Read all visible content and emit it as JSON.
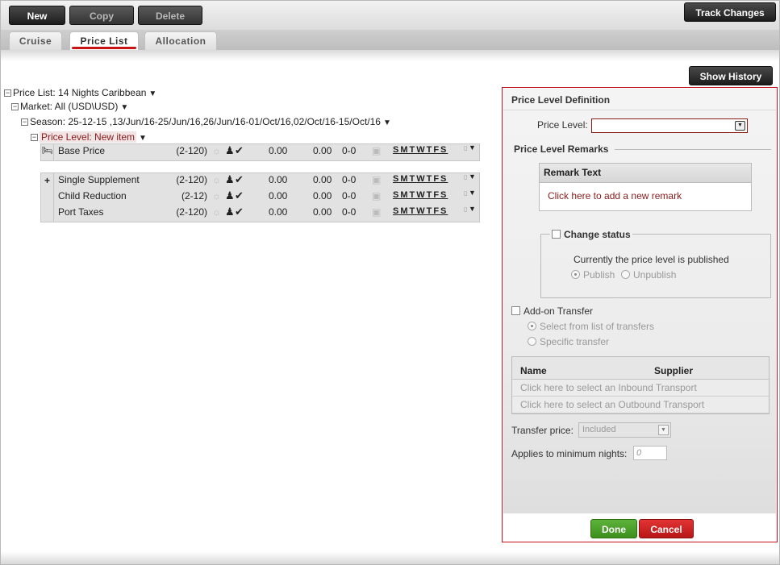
{
  "toolbar": {
    "new_label": "New",
    "copy_label": "Copy",
    "delete_label": "Delete",
    "track_changes_label": "Track Changes"
  },
  "tabs": [
    {
      "label": "Cruise",
      "active": false
    },
    {
      "label": "Price List",
      "active": true
    },
    {
      "label": "Allocation",
      "active": false
    }
  ],
  "tree": {
    "price_list": "Price List: 14 Nights Caribbean",
    "market": "Market: All (USD\\USD)",
    "season": "Season: 25-12-15 ,13/Jun/16-25/Jun/16,26/Jun/16-01/Oct/16,02/Oct/16-15/Oct/16",
    "price_level": "Price Level: New item"
  },
  "base_rows": [
    {
      "name": "Base Price",
      "range": "(2-120)",
      "v1": "0.00",
      "v2": "0.00",
      "v3": "0-0",
      "days": "SMTWTFS"
    }
  ],
  "supplement_rows": [
    {
      "name": "Single Supplement",
      "range": "(2-120)",
      "v1": "0.00",
      "v2": "0.00",
      "v3": "0-0",
      "days": "SMTWTFS"
    },
    {
      "name": "Child Reduction",
      "range": "(2-12)",
      "v1": "0.00",
      "v2": "0.00",
      "v3": "0-0",
      "days": "SMTWTFS"
    },
    {
      "name": "Port Taxes",
      "range": "(2-120)",
      "v1": "0.00",
      "v2": "0.00",
      "v3": "0-0",
      "days": "SMTWTFS"
    }
  ],
  "supplement_add_symbol": "+",
  "show_history_label": "Show History",
  "panel": {
    "title": "Price Level Definition",
    "price_level_label": "Price Level:",
    "price_level_value": "",
    "remarks_heading": "Price Level Remarks",
    "remark_text_header": "Remark Text",
    "add_remark_link": "Click here to add a new remark",
    "change_status_label": "Change status",
    "status_text": "Currently the price level is published",
    "publish_label": "Publish",
    "unpublish_label": "Unpublish",
    "addon_transfer_label": "Add-on Transfer",
    "select_from_list_label": "Select from list of transfers",
    "specific_transfer_label": "Specific transfer",
    "col_name": "Name",
    "col_supplier": "Supplier",
    "inbound_link": "Click here to select an Inbound Transport",
    "outbound_link": "Click here to select an Outbound Transport",
    "transfer_price_label": "Transfer price:",
    "transfer_price_value": "Included",
    "min_nights_label": "Applies to minimum nights:",
    "min_nights_placeholder": "0",
    "done_label": "Done",
    "cancel_label": "Cancel"
  },
  "colors": {
    "accent_red": "#c8101e",
    "done_green": "#4aa42a",
    "toolbar_dark": "#2a2a2a"
  }
}
